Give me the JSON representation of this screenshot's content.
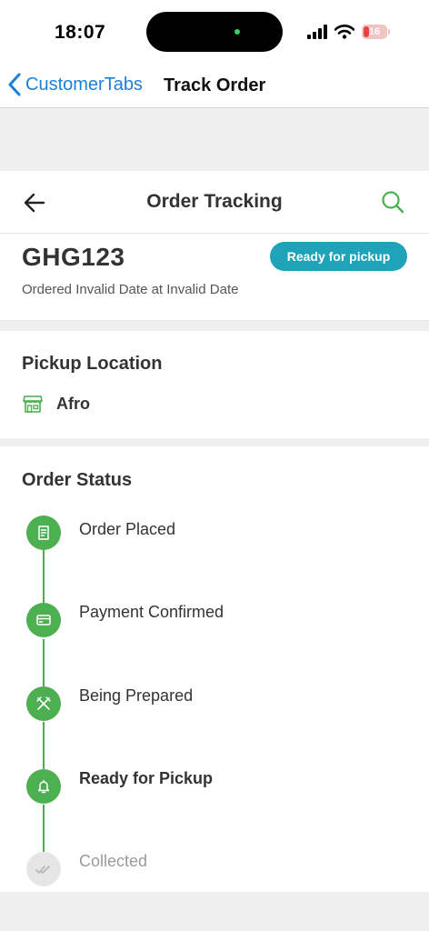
{
  "status_bar": {
    "time": "18:07",
    "battery": "16"
  },
  "nav": {
    "back_label": "CustomerTabs",
    "title": "Track Order"
  },
  "header": {
    "title": "Order Tracking"
  },
  "order": {
    "id": "GHG123",
    "status_badge": "Ready for pickup",
    "ordered_text": "Ordered Invalid Date at Invalid Date"
  },
  "pickup": {
    "title": "Pickup Location",
    "location": "Afro"
  },
  "order_status": {
    "title": "Order Status",
    "steps": [
      {
        "label": "Order Placed",
        "icon": "receipt-icon",
        "state": "done"
      },
      {
        "label": "Payment Confirmed",
        "icon": "credit-card-icon",
        "state": "done"
      },
      {
        "label": "Being Prepared",
        "icon": "utensils-icon",
        "state": "done"
      },
      {
        "label": "Ready for Pickup",
        "icon": "bell-icon",
        "state": "current"
      },
      {
        "label": "Collected",
        "icon": "double-check-icon",
        "state": "pending"
      }
    ]
  },
  "colors": {
    "accent_green": "#4caf50",
    "badge_teal": "#1fa3b8",
    "ios_blue": "#1e7fd8",
    "pending_gray": "#e6e6e6"
  }
}
